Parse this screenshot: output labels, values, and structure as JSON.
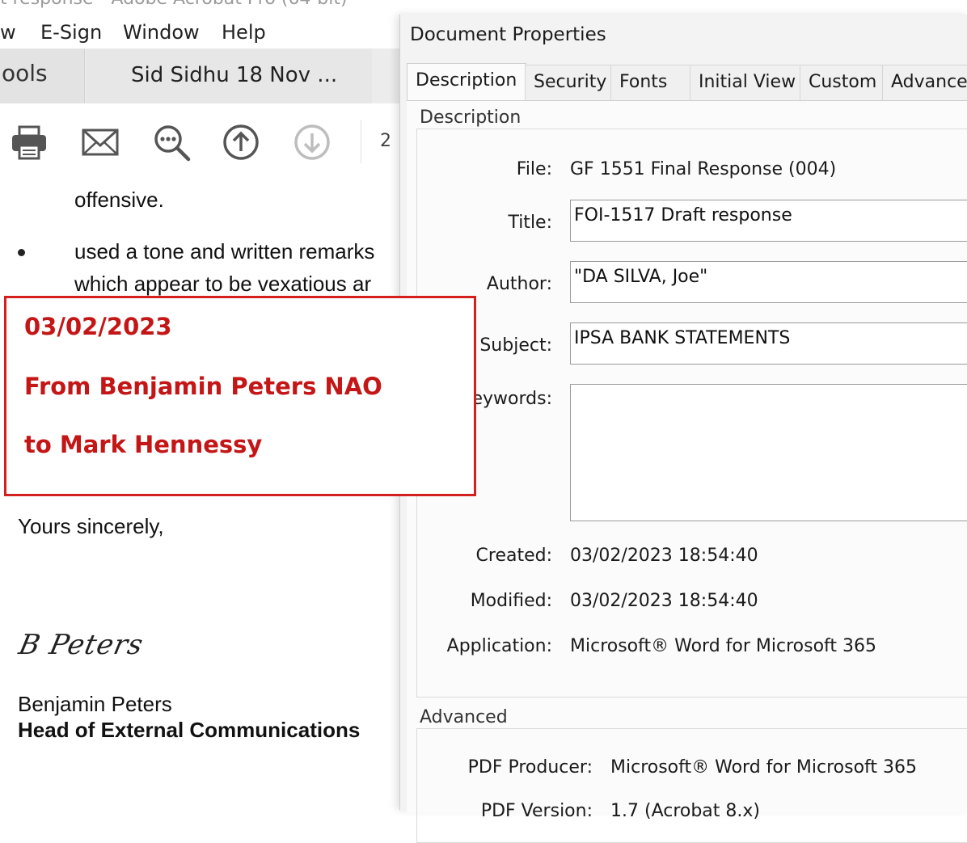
{
  "window": {
    "title_fragment": "t response - Adobe Acrobat Pro (64-bit)"
  },
  "menubar": {
    "items": [
      "w",
      "E-Sign",
      "Window",
      "Help"
    ]
  },
  "tabs_bar": {
    "tools_label": "ools",
    "document_tab": "Sid Sidhu  18 Nov ..."
  },
  "toolbar": {
    "icons": [
      "print-icon",
      "email-icon",
      "search-zoom-icon",
      "page-up-icon",
      "page-down-icon"
    ],
    "page_number": "2"
  },
  "document": {
    "line1": "offensive.",
    "bullet_line1": "used a tone and written remarks",
    "bullet_line2": "which appear to be vexatious ar",
    "closing": "Yours sincerely,",
    "signature": "B Peters",
    "signer_name": "Benjamin Peters",
    "signer_title": "Head of External Communications"
  },
  "annotation": {
    "color": "#c41616",
    "date": "03/02/2023",
    "from": "From Benjamin Peters NAO",
    "to": " to Mark Hennessy"
  },
  "dialog": {
    "title": "Document Properties",
    "tabs": [
      "Description",
      "Security",
      "Fonts",
      "Initial View",
      "Custom",
      "Advanced"
    ],
    "active_tab": "Description",
    "description": {
      "group_label": "Description",
      "file_label": "File:",
      "file_value": "GF 1551 Final Response (004)",
      "title_label": "Title:",
      "title_value": "FOI-1517 Draft response",
      "author_label": "Author:",
      "author_value": "\"DA SILVA, Joe\"",
      "subject_label": "Subject:",
      "subject_value": "IPSA BANK STATEMENTS",
      "keywords_label": "Keywords:",
      "keywords_value": "",
      "created_label": "Created:",
      "created_value": "03/02/2023 18:54:40",
      "modified_label": "Modified:",
      "modified_value": "03/02/2023 18:54:40",
      "application_label": "Application:",
      "application_value": "Microsoft® Word for Microsoft 365"
    },
    "advanced": {
      "group_label": "Advanced",
      "producer_label": "PDF Producer:",
      "producer_value": "Microsoft® Word for Microsoft 365",
      "version_label": "PDF Version:",
      "version_value": "1.7 (Acrobat 8.x)"
    }
  }
}
